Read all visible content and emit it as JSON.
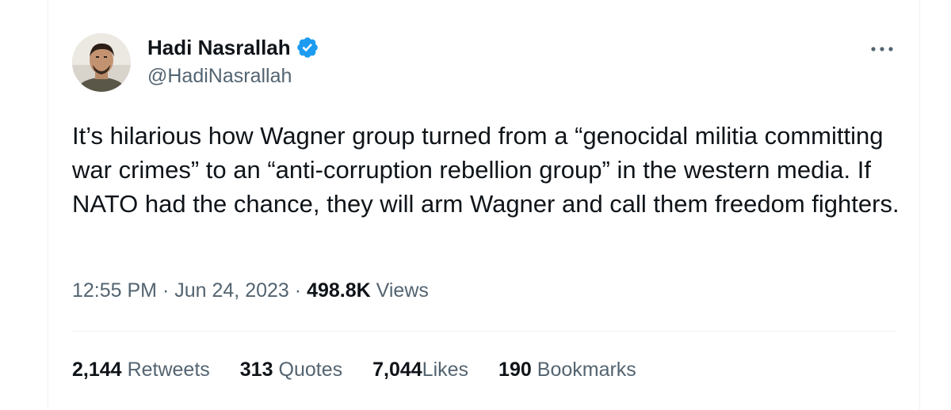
{
  "author": {
    "name": "Hadi Nasrallah",
    "handle": "@HadiNasrallah",
    "verified": true
  },
  "tweet": {
    "text": "It’s hilarious how Wagner group turned from a “genocidal militia committing war crimes” to an “anti-corruption rebellion group” in the western media. If NATO had the chance, they will arm Wagner and call them freedom fighters.",
    "time": "12:55 PM",
    "separator": "·",
    "date": "Jun 24, 2023",
    "views_count": "498.8K",
    "views_label": "Views"
  },
  "stats": {
    "retweets": {
      "count": "2,144",
      "label": "Retweets"
    },
    "quotes": {
      "count": "313",
      "label": "Quotes"
    },
    "likes": {
      "count": "7,044",
      "label": "Likes"
    },
    "bookmarks": {
      "count": "190",
      "label": "Bookmarks"
    }
  },
  "icons": {
    "verified": "verified-badge-icon",
    "more": "more-options-icon"
  },
  "colors": {
    "verified_blue": "#1d9bf0",
    "text_primary": "#0f1419",
    "text_secondary": "#536471",
    "divider": "#eff3f4"
  }
}
